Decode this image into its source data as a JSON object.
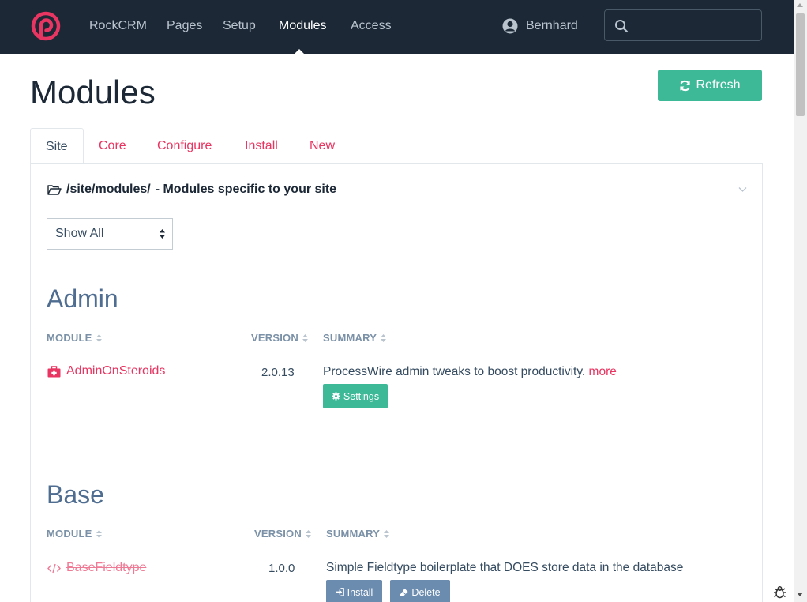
{
  "nav": {
    "items": [
      {
        "label": "RockCRM"
      },
      {
        "label": "Pages"
      },
      {
        "label": "Setup"
      },
      {
        "label": "Modules",
        "active": true
      },
      {
        "label": "Access"
      }
    ],
    "user": "Bernhard",
    "search_value": ""
  },
  "page": {
    "title": "Modules",
    "refresh_label": "Refresh"
  },
  "tabs": [
    {
      "label": "Site",
      "active": true
    },
    {
      "label": "Core"
    },
    {
      "label": "Configure"
    },
    {
      "label": "Install"
    },
    {
      "label": "New"
    }
  ],
  "panel": {
    "folder_path": "/site/modules/",
    "folder_desc": "- Modules specific to your site",
    "filter_value": "Show All"
  },
  "sections": [
    {
      "title": "Admin",
      "headers": {
        "module": "MODULE",
        "version": "VERSION",
        "summary": "SUMMARY"
      },
      "rows": [
        {
          "name": "AdminOnSteroids",
          "icon": "medkit-icon",
          "version": "2.0.13",
          "summary": "ProcessWire admin tweaks to boost productivity.",
          "more": "more",
          "buttons": [
            {
              "label": "Settings",
              "icon": "gear-icon"
            }
          ]
        }
      ]
    },
    {
      "title": "Base",
      "headers": {
        "module": "MODULE",
        "version": "VERSION",
        "summary": "SUMMARY"
      },
      "rows": [
        {
          "name": "BaseFieldtype",
          "icon": "code-icon",
          "installed": false,
          "version": "1.0.0",
          "summary": "Simple Fieldtype boilerplate that DOES store data in the database",
          "buttons": [
            {
              "label": "Install",
              "icon": "sign-in-icon"
            },
            {
              "label": "Delete",
              "icon": "eraser-icon"
            }
          ]
        }
      ]
    }
  ],
  "colors": {
    "topbar": "#1c2836",
    "accent": "#e83561",
    "green": "#3eb998",
    "heading": "#4e6d90",
    "grey_button": "#6b8caf"
  }
}
